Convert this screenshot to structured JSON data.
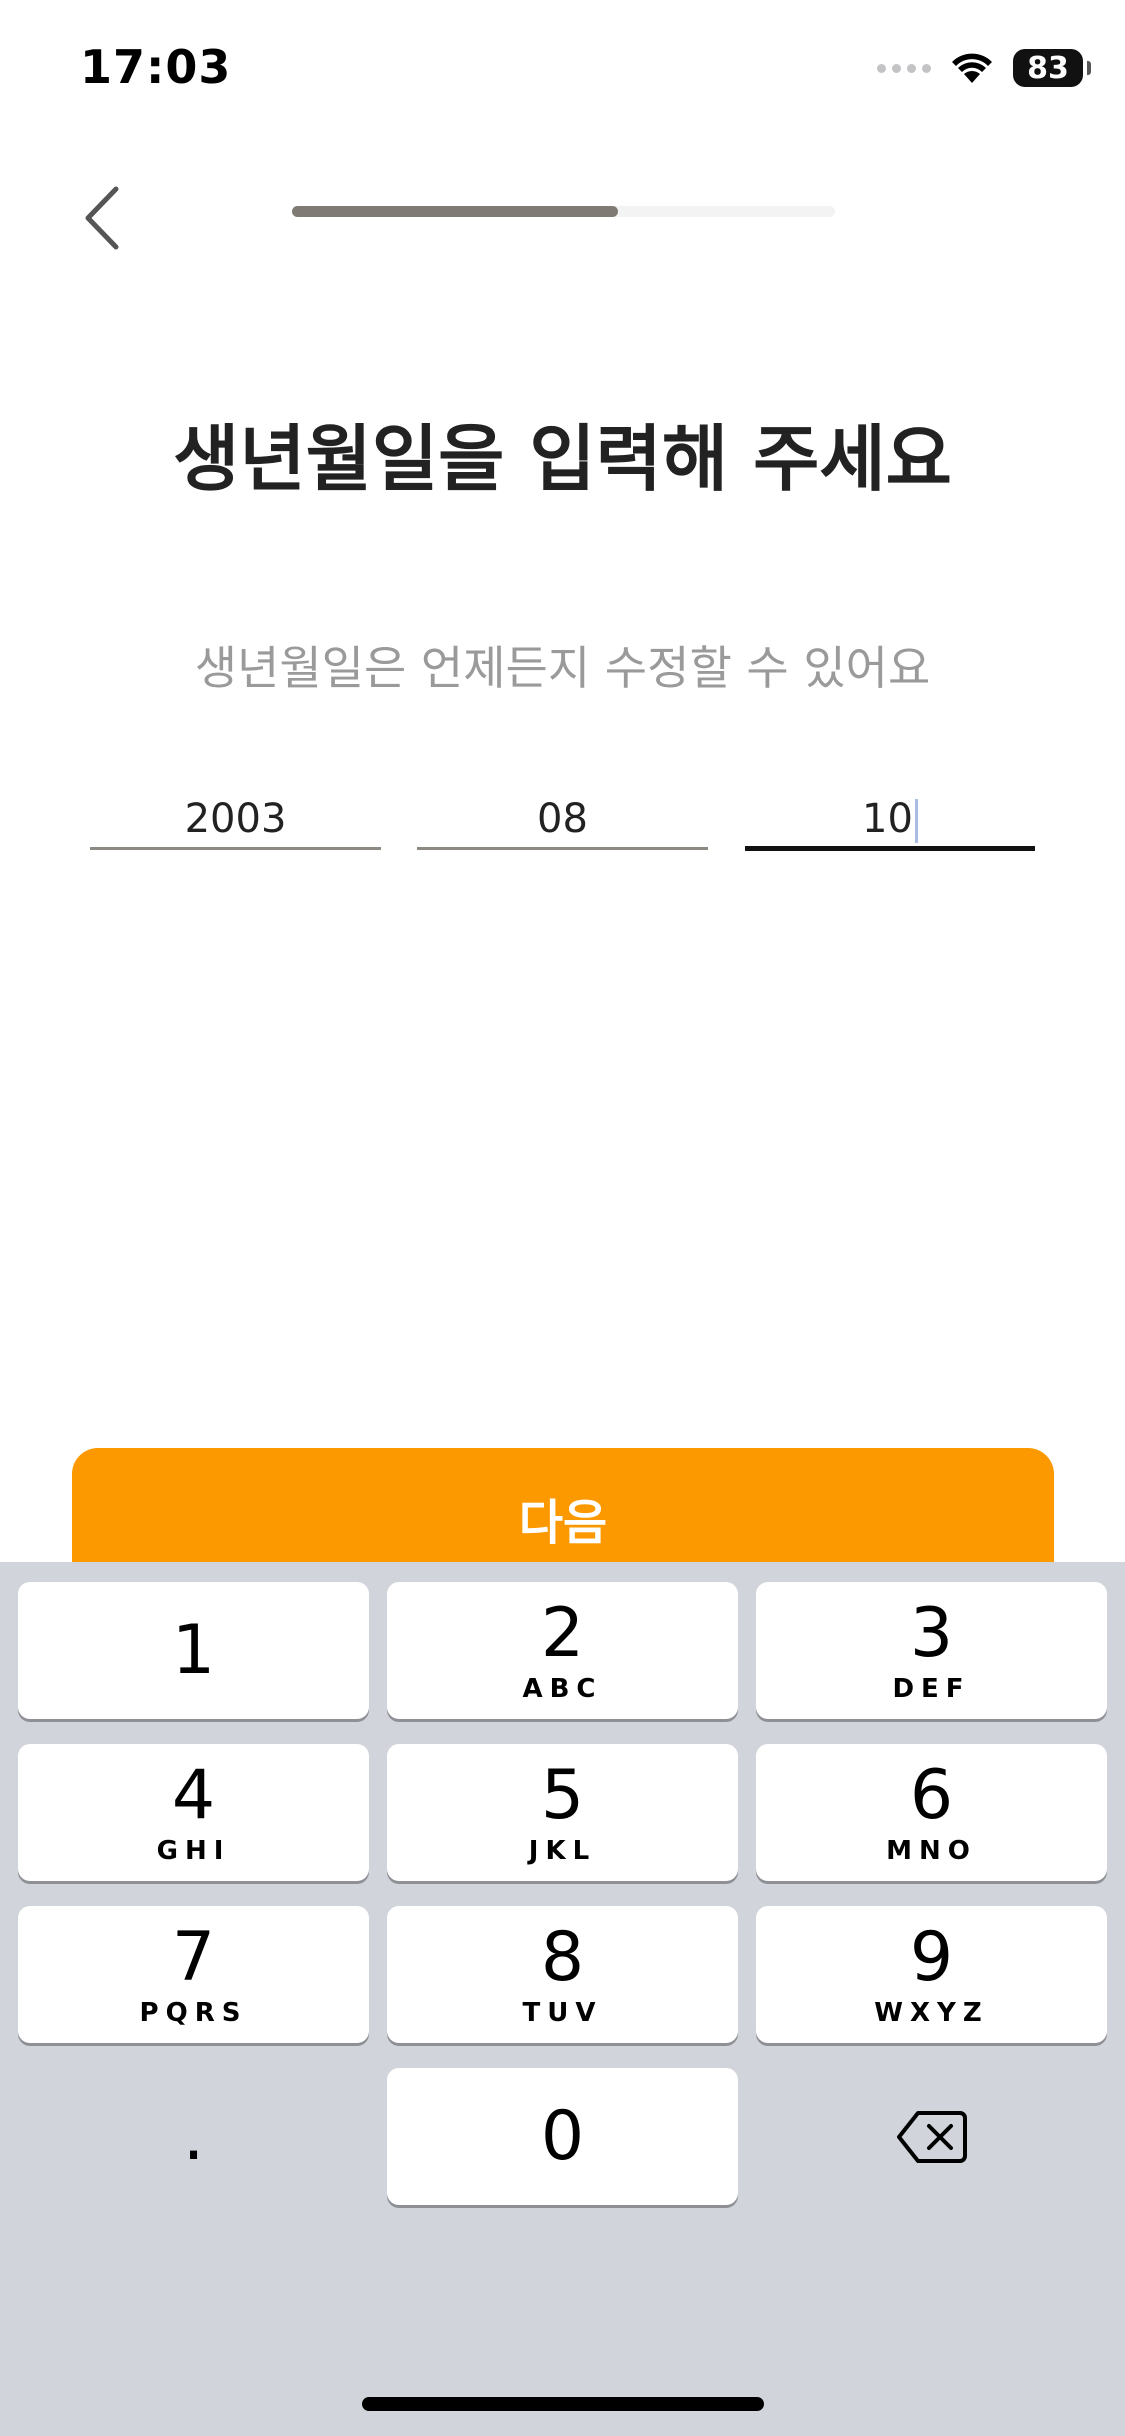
{
  "status_bar": {
    "time": "17:03",
    "battery": "83"
  },
  "header": {
    "progress_percent": 60
  },
  "title": "생년월일을 입력해 주세요",
  "subtitle": "생년월일은 언제든지 수정할 수 있어요",
  "date": {
    "year": "2003",
    "month": "08",
    "day": "10"
  },
  "next_button": {
    "label": "다음"
  },
  "keypad": {
    "keys": [
      {
        "num": "1",
        "letters": ""
      },
      {
        "num": "2",
        "letters": "ABC"
      },
      {
        "num": "3",
        "letters": "DEF"
      },
      {
        "num": "4",
        "letters": "GHI"
      },
      {
        "num": "5",
        "letters": "JKL"
      },
      {
        "num": "6",
        "letters": "MNO"
      },
      {
        "num": "7",
        "letters": "PQRS"
      },
      {
        "num": "8",
        "letters": "TUV"
      },
      {
        "num": "9",
        "letters": "WXYZ"
      },
      {
        "num": ".",
        "letters": ""
      },
      {
        "num": "0",
        "letters": ""
      }
    ]
  },
  "colors": {
    "accent": "#fc9900",
    "keyboard_bg": "#d2d4db"
  }
}
